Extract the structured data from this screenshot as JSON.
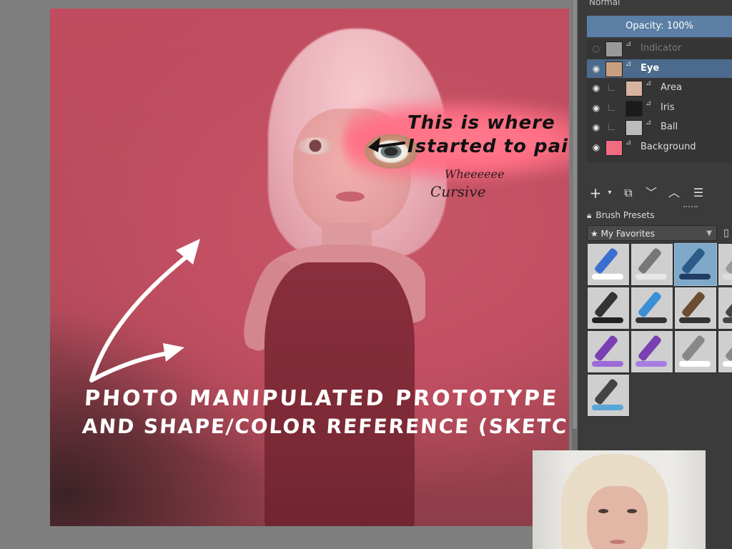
{
  "canvas": {
    "annotation_black_lines": [
      "This is where",
      "Istarted to paint"
    ],
    "annotation_cursive_lines": [
      "Wheeeeee",
      "Cursive"
    ],
    "annotation_white_lines": [
      "PHOTO MANIPULATED PROTOTYPE",
      "AND SHAPE/COLOR REFERENCE (SKETCH)"
    ]
  },
  "layers_panel": {
    "blend_mode": "Normal",
    "opacity_label": "Opacity:  100%",
    "layers": [
      {
        "name": "Indicator",
        "visible": false,
        "selected": false,
        "indent": 0
      },
      {
        "name": "Eye",
        "visible": true,
        "selected": true,
        "indent": 0
      },
      {
        "name": "Area",
        "visible": true,
        "selected": false,
        "indent": 1
      },
      {
        "name": "Iris",
        "visible": true,
        "selected": false,
        "indent": 1
      },
      {
        "name": "Ball",
        "visible": true,
        "selected": false,
        "indent": 1
      },
      {
        "name": "Background",
        "visible": true,
        "selected": false,
        "indent": 0
      }
    ],
    "toolbar_icons": [
      "add-layer-icon",
      "add-layer-dropdown-icon",
      "duplicate-layer-icon",
      "move-layer-down-icon",
      "move-layer-up-icon",
      "layer-properties-icon"
    ]
  },
  "brush_presets": {
    "title": "Brush Presets",
    "filter_label": "★ My Favorites",
    "presets": [
      {
        "name": "eraser-marker",
        "active": false,
        "stroke_color": "#ffffff",
        "tool_color": "#3a6fd1"
      },
      {
        "name": "blur-smudge",
        "active": false,
        "stroke_color": "#e6e6e6",
        "tool_color": "#777777"
      },
      {
        "name": "airbrush-soft",
        "active": true,
        "stroke_color": "#1f3d66",
        "tool_color": "#2c5b8a"
      },
      {
        "name": "extra-1",
        "active": false,
        "stroke_color": "#dddddd",
        "tool_color": "#999999"
      },
      {
        "name": "ink-pen",
        "active": false,
        "stroke_color": "#222222",
        "tool_color": "#333333"
      },
      {
        "name": "marker-fill",
        "active": false,
        "stroke_color": "#333333",
        "tool_color": "#3b8fd6"
      },
      {
        "name": "bristle-brush",
        "active": false,
        "stroke_color": "#333333",
        "tool_color": "#6a4d33"
      },
      {
        "name": "extra-2",
        "active": false,
        "stroke_color": "#444444",
        "tool_color": "#444444"
      },
      {
        "name": "wet-brush-violet",
        "active": false,
        "stroke_color": "#9b6ad8",
        "tool_color": "#7a3fb3"
      },
      {
        "name": "wet-paint-violet",
        "active": false,
        "stroke_color": "#a67de0",
        "tool_color": "#7a3fb3"
      },
      {
        "name": "wet-white",
        "active": false,
        "stroke_color": "#ffffff",
        "tool_color": "#888888"
      },
      {
        "name": "extra-3",
        "active": false,
        "stroke_color": "#ffffff",
        "tool_color": "#888888"
      },
      {
        "name": "shape-pattern",
        "active": false,
        "stroke_color": "#5aa6d8",
        "tool_color": "#444444"
      }
    ]
  },
  "colors": {
    "accent": "#5b7fa5",
    "selected_row": "#4b6a8c",
    "panel_bg": "#3b3b3b",
    "canvas_bg": "#c14f61"
  }
}
